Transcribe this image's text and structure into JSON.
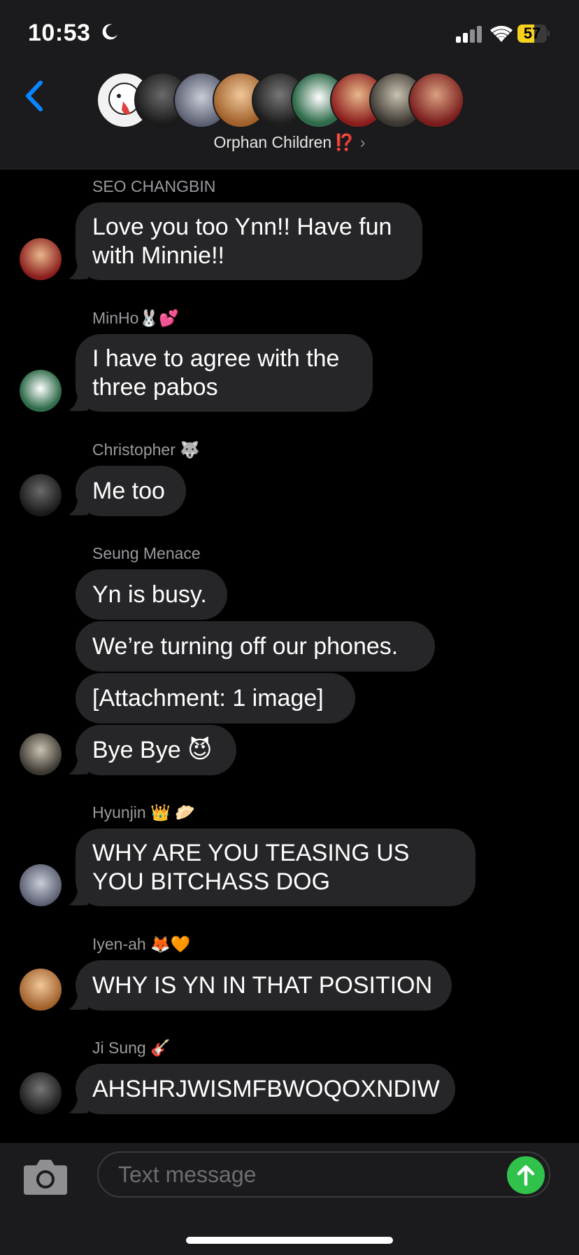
{
  "status_bar": {
    "time": "10:53",
    "battery": "57",
    "battery_level": 0.57
  },
  "header": {
    "group_name": "Orphan Children",
    "emoji": "⁉️",
    "chevron": "›"
  },
  "messages": [
    {
      "sender": "SEO CHANGBIN",
      "bubbles": [
        "Love you too Ynn!! Have fun with Minnie!!"
      ]
    },
    {
      "sender": "MinHo🐰💕",
      "bubbles": [
        "I have to agree with the three pabos"
      ]
    },
    {
      "sender": "Christopher 🐺",
      "bubbles": [
        "Me too"
      ]
    },
    {
      "sender": "Seung Menace",
      "bubbles": [
        "Yn is busy.",
        "We’re turning off our phones.",
        "[Attachment: 1 image]",
        "Bye Bye 😈"
      ]
    },
    {
      "sender": "Hyunjin 👑 🥟",
      "bubbles": [
        "WHY ARE YOU TEASING US YOU BITCHASS DOG"
      ]
    },
    {
      "sender": "Iyen-ah 🦊🧡",
      "bubbles": [
        "WHY IS YN IN THAT POSITION"
      ]
    },
    {
      "sender": "Ji Sung 🎸",
      "bubbles": [
        "AHSHRJWISMFBWOQOXNDIW"
      ]
    }
  ],
  "composer": {
    "placeholder": "Text message"
  },
  "colors": {
    "accent_blue": "#0a84ff",
    "bubble": "#262629",
    "send_green": "#30c24a",
    "battery_yellow": "#f6d11e"
  }
}
